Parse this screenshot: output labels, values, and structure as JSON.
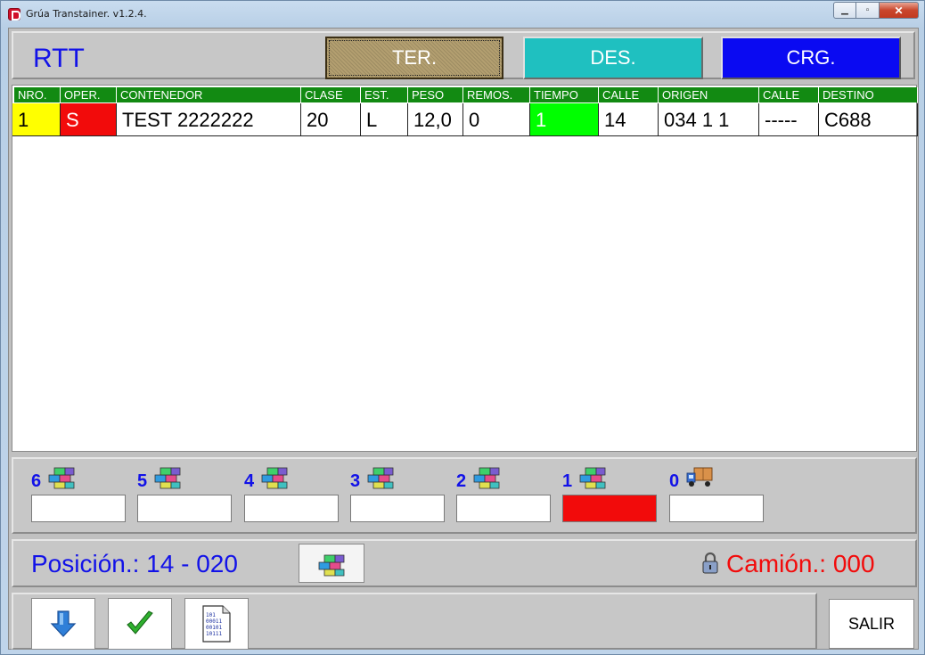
{
  "window": {
    "title": "Grúa Transtainer. v1.2.4.",
    "controls": {
      "minimize": "▁",
      "maximize": "▫",
      "close": "✕"
    }
  },
  "header": {
    "label": "RTT",
    "modes": [
      {
        "label": "TER.",
        "color": "#b39f70",
        "selected": true
      },
      {
        "label": "DES.",
        "color": "#1fc0c0",
        "selected": false
      },
      {
        "label": "CRG.",
        "color": "#0a0af2",
        "selected": false
      }
    ]
  },
  "grid": {
    "columns": [
      "NRO.",
      "OPER.",
      "CONTENEDOR",
      "CLASE",
      "EST.",
      "PESO",
      "REMOS.",
      "TIEMPO",
      "CALLE",
      "ORIGEN",
      "CALLE",
      "DESTINO"
    ],
    "rows": [
      [
        "1",
        "S",
        "TEST 2222222",
        "20",
        "L",
        "12,0",
        "0",
        "1",
        "14",
        "034 1 1",
        "-----",
        "C688"
      ]
    ],
    "cell_colors": {
      "nro": "#ffff00",
      "oper": "#f20b0b",
      "tiempo": "#00ff00",
      "header": "#128a12"
    }
  },
  "levels": [
    {
      "number": "6",
      "icon": "containers-stack-icon",
      "active": false
    },
    {
      "number": "5",
      "icon": "containers-stack-icon",
      "active": false
    },
    {
      "number": "4",
      "icon": "containers-stack-icon",
      "active": false
    },
    {
      "number": "3",
      "icon": "containers-stack-icon",
      "active": false
    },
    {
      "number": "2",
      "icon": "containers-stack-icon",
      "active": false
    },
    {
      "number": "1",
      "icon": "containers-stack-icon",
      "active": true
    },
    {
      "number": "0",
      "icon": "truck-icon",
      "active": false
    }
  ],
  "status": {
    "posicion": "Posición.: 14 - 020",
    "camion": "Camión.: 000",
    "lock_icon": "padlock-icon"
  },
  "toolbar": {
    "down_icon": "arrow-down-icon",
    "confirm_icon": "checkmark-icon",
    "document_icon": "binary-document-icon",
    "exit_label": "SALIR"
  }
}
